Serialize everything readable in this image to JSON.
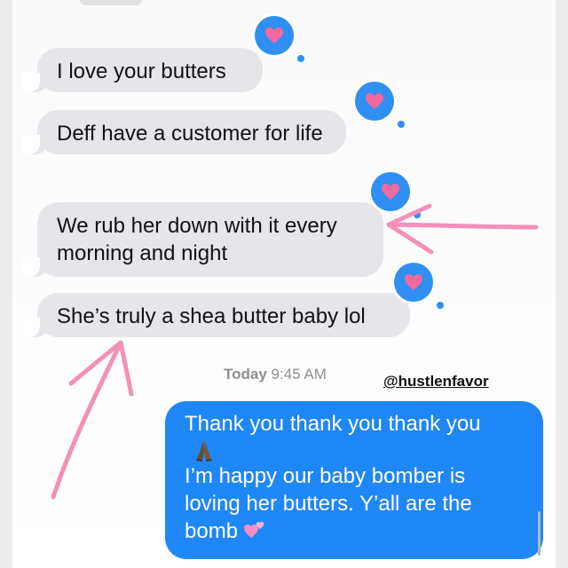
{
  "conversation": {
    "incoming": [
      {
        "text_lines": [
          "I love your butters"
        ],
        "reaction": "heart-icon"
      },
      {
        "text_lines": [
          "Deff have a customer for life"
        ],
        "reaction": "heart-icon"
      },
      {
        "text_lines": [
          "We rub her down with it every",
          "morning and night"
        ],
        "reaction": "heart-icon"
      },
      {
        "text_lines": [
          "She’s truly a shea butter baby lol"
        ],
        "reaction": "heart-icon"
      }
    ],
    "timestamp": {
      "day": "Today",
      "time": "9:45 AM"
    },
    "watermark": "@hustlenfavor",
    "outgoing": {
      "line1": "Thank you thank you thank you",
      "emoji1": "folded-hands-emoji",
      "line2": "I’m happy our baby bomber is",
      "line3": "loving her butters.  Y’all are the",
      "line4": "bomb",
      "emoji2": "two-hearts-emoji"
    }
  },
  "colors": {
    "incoming_bubble": "#e5e5ea",
    "outgoing_bubble": "#1f87f7",
    "tapback": "#2f8ff2",
    "heart": "#f06a9f",
    "annotation_arrow": "#f48fb8"
  }
}
